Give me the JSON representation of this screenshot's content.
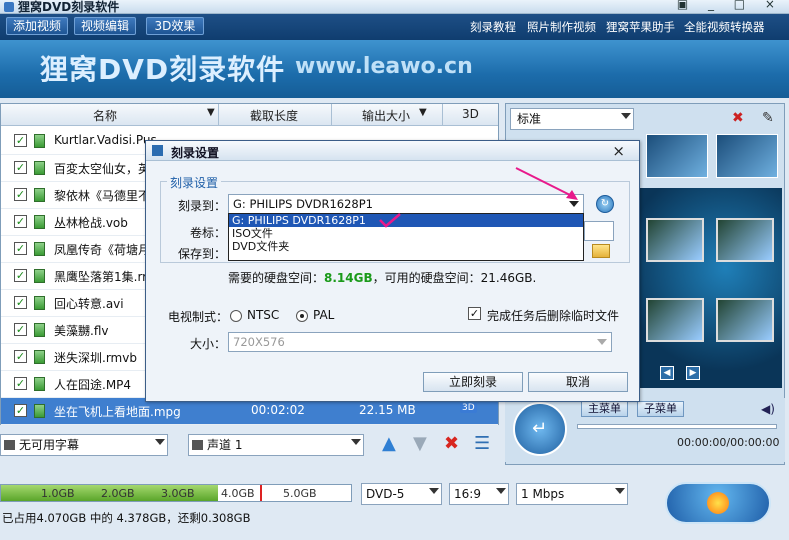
{
  "window": {
    "title": "狸窝DVD刻录软件",
    "controls": "▣ _ □ ×"
  },
  "toolbar": {
    "add_video": "添加视频",
    "edit_video": "视频编辑",
    "effect_3d": "3D效果",
    "links": [
      "刻录教程",
      "照片制作视频",
      "狸窝苹果助手",
      "全能视频转换器"
    ]
  },
  "banner": {
    "brand": "狸窝DVD刻录软件",
    "url": "www.leawo.cn"
  },
  "list": {
    "headers": [
      "名称",
      "截取长度",
      "输出大小",
      "3D"
    ],
    "rows": [
      {
        "name": "Kurtlar.Vadisi.Pus...",
        "checked": true
      },
      {
        "name": "百変太空仙女，英",
        "checked": true
      },
      {
        "name": "黎依林《马德里不",
        "checked": true
      },
      {
        "name": "丛林枪战.vob",
        "checked": true
      },
      {
        "name": "凤凰传奇《荷塘月",
        "checked": true
      },
      {
        "name": "黑鹰坠落第1集.rr",
        "checked": true
      },
      {
        "name": "回心转意.avi",
        "checked": true
      },
      {
        "name": "美藻嬲.flv",
        "checked": true
      },
      {
        "name": "迷失深圳.rmvb",
        "checked": true
      },
      {
        "name": "人在囧途.MP4",
        "checked": true
      },
      {
        "name": "坐在飞机上看地面.mpg",
        "checked": true,
        "length": "00:02:02",
        "size": "22.15 MB",
        "tag": "3D",
        "selected": true
      }
    ],
    "subtitle_select": "无可用字幕",
    "audio_select": "声道 1",
    "check_mark": "✓"
  },
  "right_panel": {
    "template_select": "标准",
    "main_menu": "主菜单",
    "sub_menu": "子菜单",
    "time": "00:00:00/00:00:00",
    "nav_prev": "◀",
    "nav_next": "▶"
  },
  "bottom": {
    "capacity_ticks": [
      "1.0GB",
      "2.0GB",
      "3.0GB",
      "4.0GB",
      "5.0GB"
    ],
    "capacity_fraction": 0.86,
    "disc_type": "DVD-5",
    "aspect": "16:9",
    "bitrate": "1 Mbps",
    "usage_text": "已占用4.070GB 中的 4.378GB，还剩0.308GB"
  },
  "dialog": {
    "title": "刻录设置",
    "group_title": "刻录设置",
    "burn_to_label": "刻录到：",
    "burn_to_value": "G: PHILIPS  DVDR1628P1",
    "volume_label": "卷标：",
    "save_label": "保存到：",
    "dropdown_options": [
      "G: PHILIPS  DVDR1628P1",
      "ISO文件",
      "DVD文件夹"
    ],
    "disk_space_text_prefix": "需要的硬盘空间：",
    "disk_space_needed": "8.14GB",
    "disk_space_text_mid": "，可用的硬盘空间：",
    "disk_space_available": "21.46GB.",
    "tv_label": "电视制式：",
    "ntsc": "NTSC",
    "pal": "PAL",
    "delete_temp_label": "完成任务后删除临时文件",
    "size_label": "大小：",
    "size_value": "720X576",
    "burn_now": "立即刻录",
    "cancel": "取消",
    "close": "×",
    "check_mark": "✓"
  },
  "colors": {
    "accent": "#1f57b5",
    "annotation": "#e8198b",
    "green_value": "#1a9a1a"
  }
}
